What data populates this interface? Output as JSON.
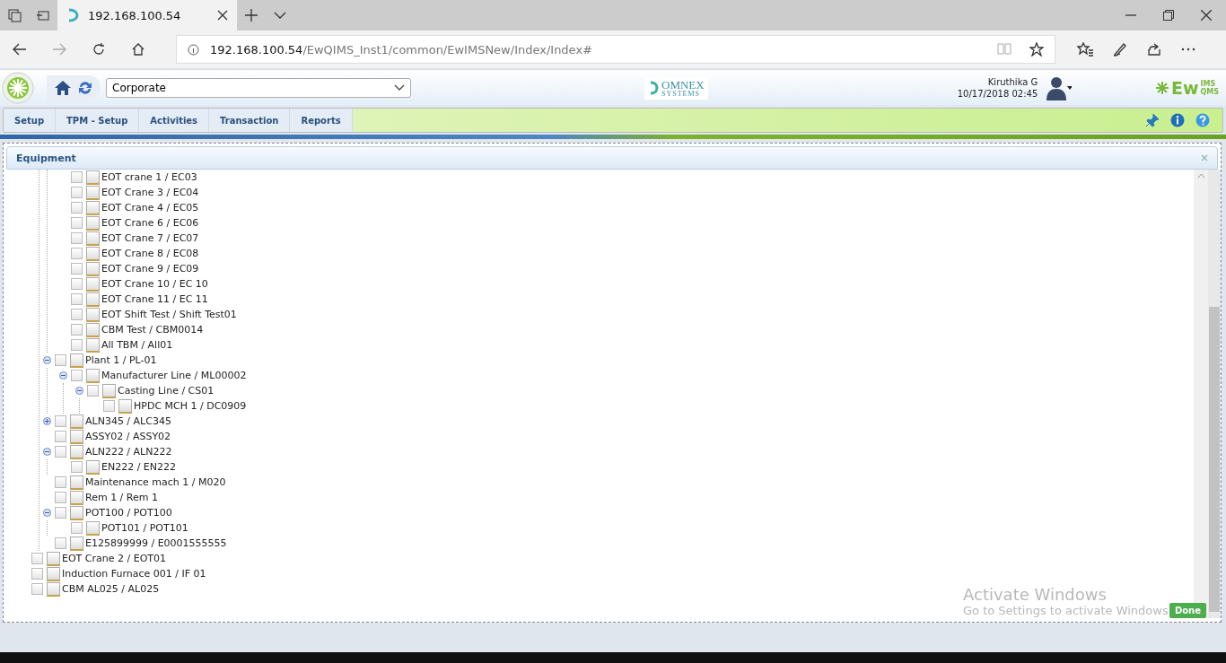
{
  "browser": {
    "tab_title": "192.168.100.54",
    "url_host": "192.168.100.54",
    "url_path": "/EwQIMS_Inst1/common/EwIMSNew/Index/Index#"
  },
  "header": {
    "site_select": {
      "value": "Corporate"
    },
    "company_logo": {
      "main": "OMNEX",
      "sub": "SYSTEMS"
    },
    "user": {
      "name": "Kiruthika G",
      "datetime": "10/17/2018 02:45"
    },
    "product_logo": {
      "main": "Ew",
      "sup": "IMS",
      "sub": "QMS"
    }
  },
  "menu": [
    "Setup",
    "TPM - Setup",
    "Activities",
    "Transaction",
    "Reports"
  ],
  "panel": {
    "title": "Equipment",
    "tree": [
      {
        "children": [
          {
            "children": [
              {
                "label": "EOT crane 1 / EC03",
                "checked": false
              },
              {
                "label": "EOT Crane 3 / EC04",
                "checked": false
              },
              {
                "label": "EOT Crane 4 / EC05",
                "checked": false
              },
              {
                "label": "EOT Crane 6 / EC06",
                "checked": false
              },
              {
                "label": "EOT Crane 7 / EC07",
                "checked": false
              },
              {
                "label": "EOT Crane 8 / EC08",
                "checked": false
              },
              {
                "label": "EOT Crane 9 / EC09",
                "checked": false
              },
              {
                "label": "EOT Crane 10 / EC 10",
                "checked": false
              },
              {
                "label": "EOT Crane 11 / EC 11",
                "checked": false
              },
              {
                "label": "EOT Shift Test / Shift Test01",
                "checked": false
              },
              {
                "label": "CBM Test / CBM0014",
                "checked": false
              },
              {
                "label": "All TBM / All01",
                "checked": false
              }
            ]
          },
          {
            "label": "Plant 1 / PL-01",
            "checked": false,
            "expanded": true,
            "children": [
              {
                "label": "Manufacturer Line / ML00002",
                "checked": false,
                "expanded": true,
                "children": [
                  {
                    "label": "Casting Line / CS01",
                    "checked": false,
                    "expanded": true,
                    "children": [
                      {
                        "label": "HPDC MCH 1 / DC0909",
                        "checked": false
                      }
                    ]
                  }
                ]
              }
            ]
          },
          {
            "label": "ALN345 / ALC345",
            "checked": false,
            "expanded": false
          },
          {
            "label": "ASSY02 / ASSY02",
            "checked": false
          },
          {
            "label": "ALN222 / ALN222",
            "checked": false,
            "expanded": true,
            "children": [
              {
                "label": "EN222 / EN222",
                "checked": false
              }
            ]
          },
          {
            "label": "Maintenance mach 1 / M020",
            "checked": false
          },
          {
            "label": "Rem 1 / Rem 1",
            "checked": false
          },
          {
            "label": "POT100 / POT100",
            "checked": false,
            "expanded": true,
            "children": [
              {
                "label": "POT101 / POT101",
                "checked": false
              }
            ]
          },
          {
            "label": "E125899999 / E0001555555",
            "checked": false
          }
        ]
      },
      {
        "label": "EOT Crane 2 / EOT01",
        "checked": false
      },
      {
        "label": "Induction Furnace 001 / IF 01",
        "checked": false
      },
      {
        "label": "CBM AL025 / AL025",
        "checked": false
      }
    ],
    "done_button": "Done"
  },
  "os_notice": {
    "title": "Activate Windows",
    "text": "Go to Settings to activate Windows"
  }
}
